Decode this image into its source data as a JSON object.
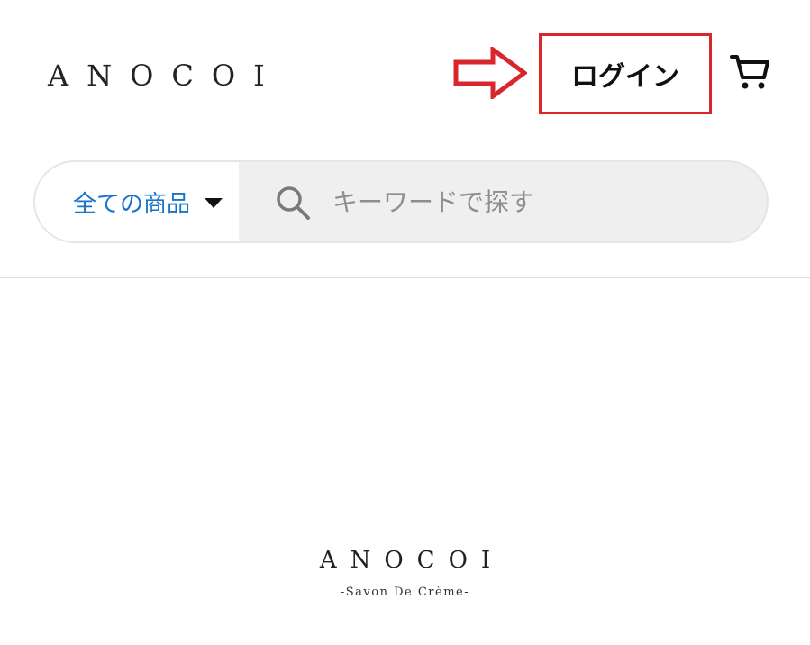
{
  "header": {
    "logo_text": "ANOCOI",
    "login_label": "ログイン",
    "cart_icon": "cart-icon",
    "annotation_arrow_icon": "arrow-right-outline-icon",
    "annotation_color": "#d9262c"
  },
  "search": {
    "category_label": "全ての商品",
    "placeholder": "キーワードで探す",
    "search_icon": "search-icon"
  },
  "brand": {
    "name": "ANOCOI",
    "tagline": "-Savon De Crème-"
  },
  "colors": {
    "category_text": "#1a73c8",
    "search_bg": "#efefef",
    "highlight": "#d9262c"
  }
}
